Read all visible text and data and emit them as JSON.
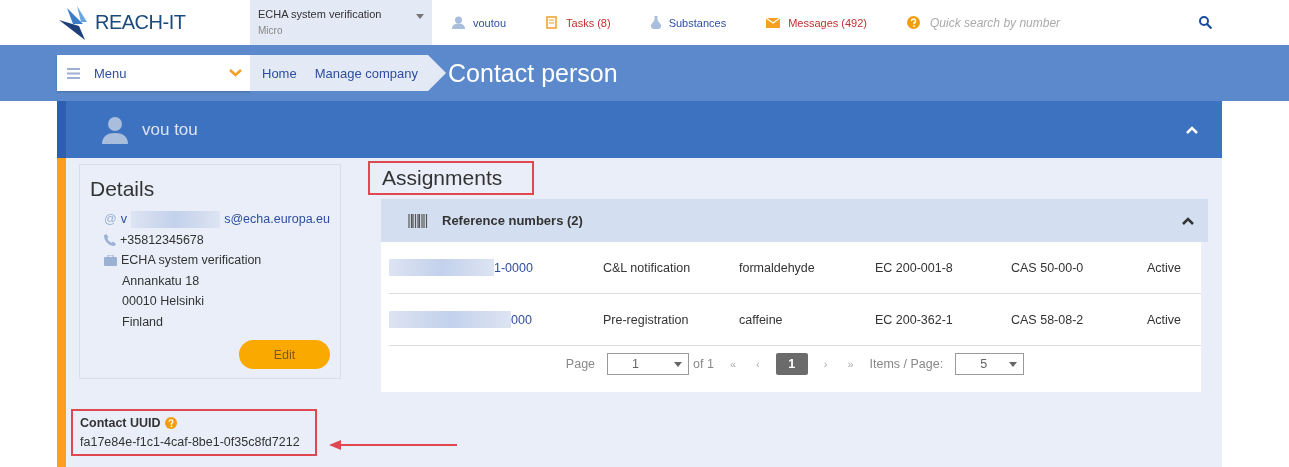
{
  "header": {
    "logo": "REACH-IT",
    "company": {
      "name": "ECHA system verification",
      "size": "Micro"
    },
    "user": "voutou",
    "tasks": "Tasks (8)",
    "substances": "Substances",
    "messages": "Messages (492)",
    "search": {
      "placeholder": "Quick search by number"
    }
  },
  "nav": {
    "menu": "Menu",
    "breadcrumbs": [
      "Home",
      "Manage company"
    ],
    "page_title": "Contact person"
  },
  "person": {
    "name": "vou tou",
    "expanded": true
  },
  "details": {
    "title": "Details",
    "email_mark": "@",
    "email_start": "v",
    "email_end": "s@echa.europa.eu",
    "phone": "+35812345678",
    "company": "ECHA system verification",
    "address": [
      "Annankatu 18",
      "00010 Helsinki",
      "Finland"
    ],
    "edit": "Edit"
  },
  "assignments": {
    "title": "Assignments",
    "panel": {
      "title": "Reference numbers (2)",
      "expanded": true
    },
    "rows": [
      {
        "reference": "1-0000",
        "type": "C&L notification",
        "substance": "formaldehyde",
        "ec": "EC 200-001-8",
        "cas": "CAS 50-00-0",
        "status": "Active"
      },
      {
        "reference": "000",
        "type": "Pre-registration",
        "substance": "caffeine",
        "ec": "EC 200-362-1",
        "cas": "CAS 58-08-2",
        "status": "Active"
      }
    ],
    "pagination": {
      "page_label": "Page",
      "page_value": "1",
      "of": "of 1",
      "first": "«",
      "prev": "‹",
      "pages": [
        {
          "label": "1",
          "selected": true
        }
      ],
      "next": "›",
      "last": "»",
      "items_label": "Items / Page:",
      "items_value": "5"
    }
  },
  "uuid": {
    "label": "Contact UUID",
    "value": "fa17e84e-f1c1-4caf-8be1-0f35c8fd7212"
  }
}
